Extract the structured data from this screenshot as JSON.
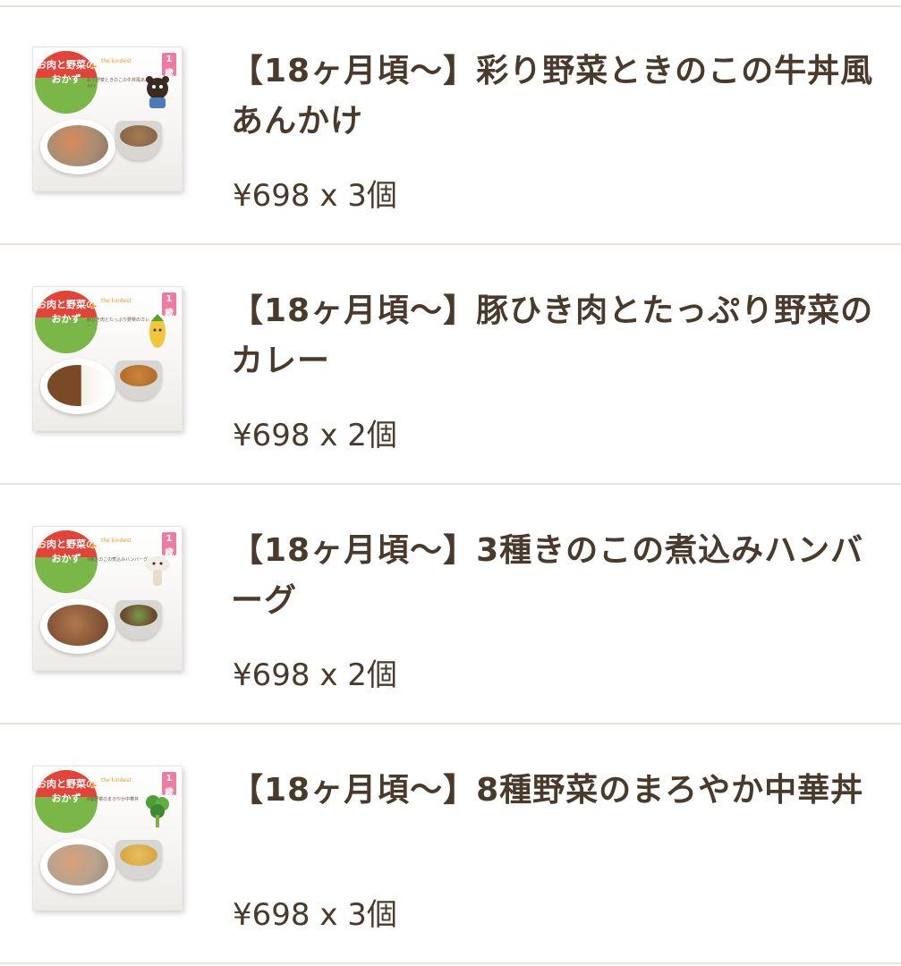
{
  "items": [
    {
      "title": "【18ヶ月頃〜】彩り野菜ときのこの牛丼風あんかけ",
      "price": "¥698 x 3個",
      "thumbnail": {
        "badge": "お肉と野菜のおかず",
        "brand": "the kindest",
        "age": "1歳",
        "desc": "彩り野菜ときのこの牛丼風あんかけ",
        "plate_color": "#a98e74",
        "bowl_color": "#8b6a4a"
      }
    },
    {
      "title": "【18ヶ月頃〜】豚ひき肉とたっぷり野菜のカレー",
      "price": "¥698 x 2個",
      "thumbnail": {
        "badge": "お肉と野菜のおかず",
        "brand": "the kindest",
        "age": "1歳",
        "desc": "豚ひき肉とたっぷり野菜のカレー",
        "plate_color": "#7a4a26",
        "bowl_color": "#b5702e"
      }
    },
    {
      "title": "【18ヶ月頃〜】3種きのこの煮込みハンバーグ",
      "price": "¥698 x 2個",
      "thumbnail": {
        "badge": "お肉と野菜のおかず",
        "brand": "the kindest",
        "age": "1歳",
        "desc": "3種きのこの煮込みハンバーグ",
        "plate_color": "#8a5a3a",
        "bowl_color": "#6b4a2e"
      }
    },
    {
      "title": "【18ヶ月頃〜】8種野菜のまろやか中華丼",
      "price": "¥698 x 3個",
      "thumbnail": {
        "badge": "お肉と野菜のおかず",
        "brand": "the kindest",
        "age": "1歳",
        "desc": "8種野菜のまろやか中華丼",
        "plate_color": "#b8a38e",
        "bowl_color": "#d7a84a"
      }
    }
  ],
  "colors": {
    "text": "#4a3a2c",
    "divider": "#e7e2dd",
    "badge_red": "#e2443a",
    "badge_green": "#7ab648",
    "brand_orange": "#f29a30",
    "age_pink": "#f07aa0"
  }
}
